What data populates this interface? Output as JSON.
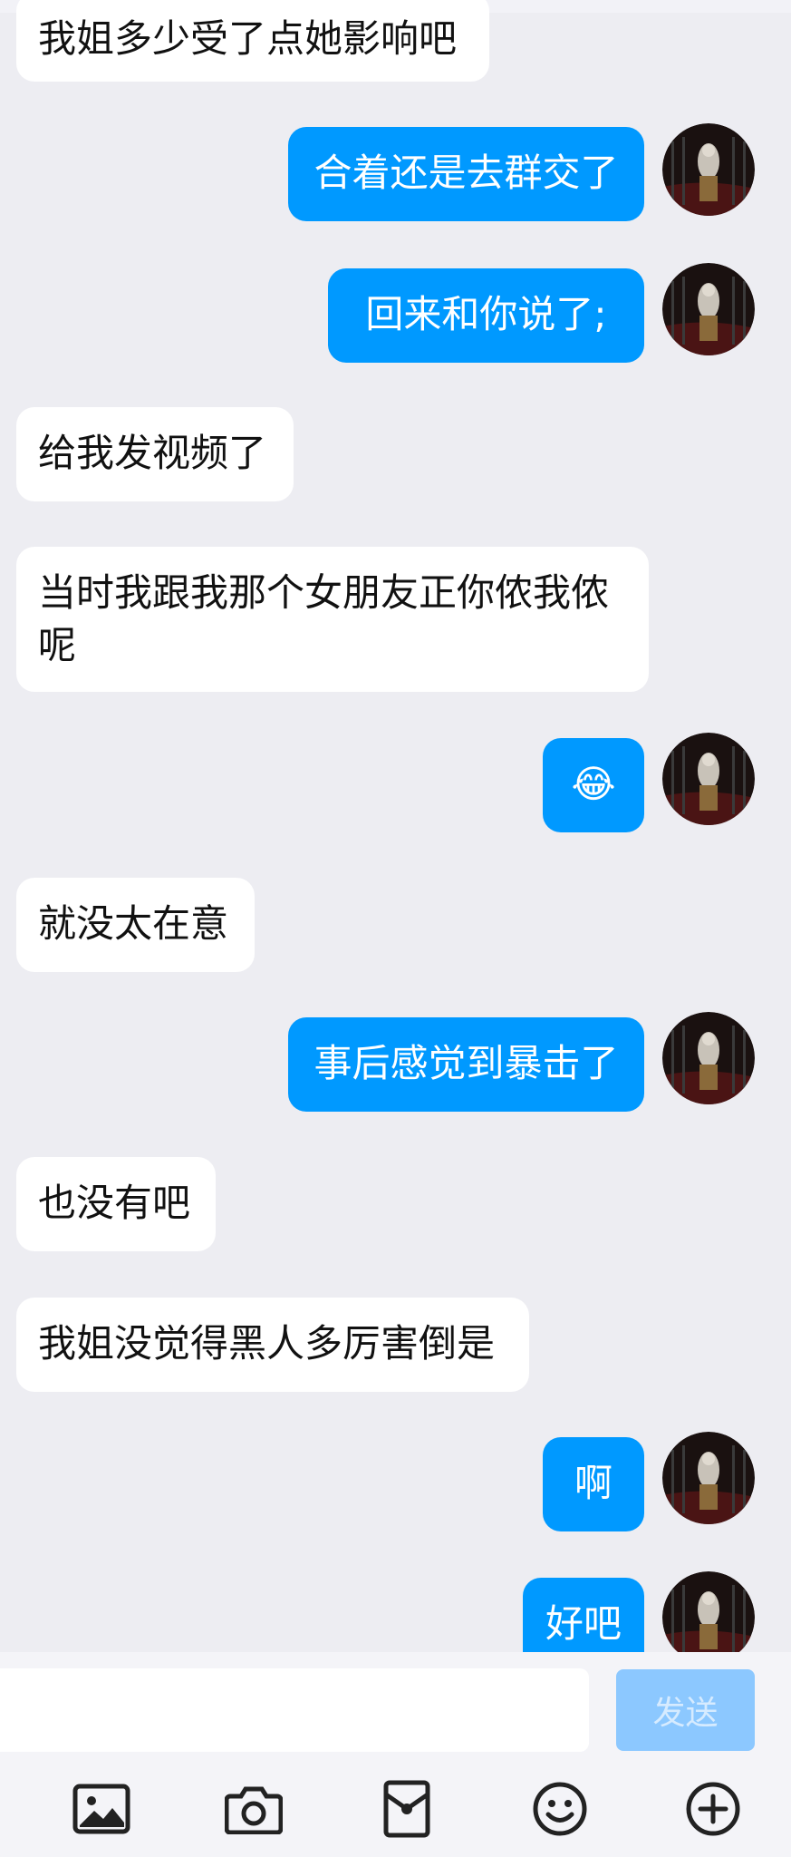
{
  "messages": [
    {
      "side": "left",
      "text": "我姐多少受了点她影响吧"
    },
    {
      "side": "right",
      "text": "合着还是去群交了"
    },
    {
      "side": "right",
      "text": "回来和你说了;"
    },
    {
      "side": "left",
      "text": "给我发视频了"
    },
    {
      "side": "left",
      "text": "当时我跟我那个女朋友正你侬我侬呢"
    },
    {
      "side": "right",
      "text": "😂"
    },
    {
      "side": "left",
      "text": "就没太在意"
    },
    {
      "side": "right",
      "text": "事后感觉到暴击了"
    },
    {
      "side": "left",
      "text": "也没有吧"
    },
    {
      "side": "left",
      "text": "我姐没觉得黑人多厉害倒是"
    },
    {
      "side": "right",
      "text": "啊"
    },
    {
      "side": "right",
      "text": "好吧"
    }
  ],
  "input": {
    "placeholder": "",
    "value": ""
  },
  "send_label": "发送",
  "toolbar": [
    {
      "icon": "image-icon"
    },
    {
      "icon": "camera-icon"
    },
    {
      "icon": "red-packet-icon"
    },
    {
      "icon": "emoji-icon"
    },
    {
      "icon": "plus-icon"
    }
  ],
  "colors": {
    "background": "#ededf2",
    "outgoing_bubble": "#0099ff",
    "incoming_bubble": "#ffffff",
    "send_button_disabled": "#8cc8ff"
  }
}
